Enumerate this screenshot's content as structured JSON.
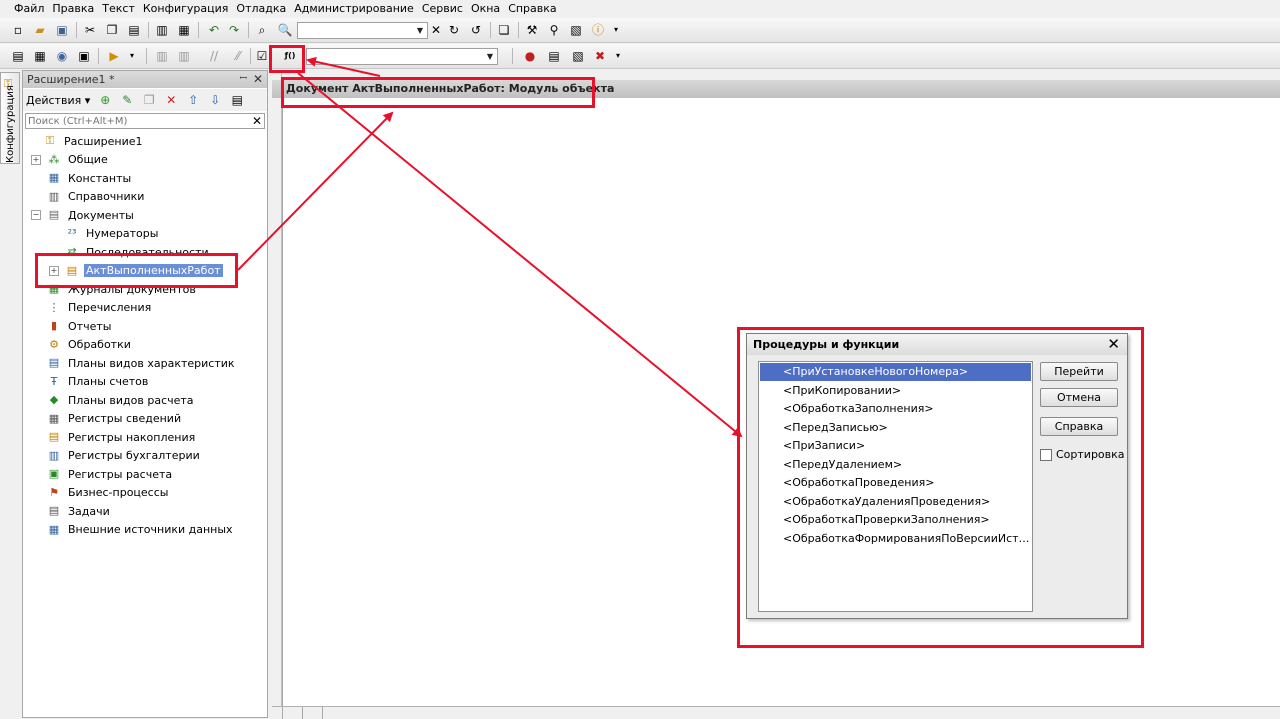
{
  "menu": [
    "Файл",
    "Правка",
    "Текст",
    "Конфигурация",
    "Отладка",
    "Администрирование",
    "Сервис",
    "Окна",
    "Справка"
  ],
  "vertical_tab": "Конфигурация",
  "panel": {
    "title": "Расширение1 *",
    "actions_label": "Действия ▾",
    "search_placeholder": "Поиск (Ctrl+Alt+M)"
  },
  "tree": [
    {
      "label": "Расширение1",
      "icon": "extension-icon",
      "level": 0,
      "expander": ""
    },
    {
      "label": "Общие",
      "icon": "common-icon",
      "level": 1,
      "expander": "+"
    },
    {
      "label": "Константы",
      "icon": "constants-icon",
      "level": 1,
      "expander": ""
    },
    {
      "label": "Справочники",
      "icon": "catalogs-icon",
      "level": 1,
      "expander": ""
    },
    {
      "label": "Документы",
      "icon": "documents-icon",
      "level": 1,
      "expander": "−"
    },
    {
      "label": "Нумераторы",
      "icon": "numerators-icon",
      "level": 2,
      "expander": ""
    },
    {
      "label": "Последовательности",
      "icon": "sequences-icon",
      "level": 2,
      "expander": ""
    },
    {
      "label": "АктВыполненныхРабот",
      "icon": "document-icon",
      "level": 2,
      "expander": "+",
      "selected": true
    },
    {
      "label": "Журналы документов",
      "icon": "journals-icon",
      "level": 1,
      "expander": ""
    },
    {
      "label": "Перечисления",
      "icon": "enums-icon",
      "level": 1,
      "expander": ""
    },
    {
      "label": "Отчеты",
      "icon": "reports-icon",
      "level": 1,
      "expander": ""
    },
    {
      "label": "Обработки",
      "icon": "processing-icon",
      "level": 1,
      "expander": ""
    },
    {
      "label": "Планы видов характеристик",
      "icon": "chart-char-icon",
      "level": 1,
      "expander": ""
    },
    {
      "label": "Планы счетов",
      "icon": "chart-accounts-icon",
      "level": 1,
      "expander": ""
    },
    {
      "label": "Планы видов расчета",
      "icon": "chart-calc-icon",
      "level": 1,
      "expander": ""
    },
    {
      "label": "Регистры сведений",
      "icon": "info-register-icon",
      "level": 1,
      "expander": ""
    },
    {
      "label": "Регистры накопления",
      "icon": "accum-register-icon",
      "level": 1,
      "expander": ""
    },
    {
      "label": "Регистры бухгалтерии",
      "icon": "account-register-icon",
      "level": 1,
      "expander": ""
    },
    {
      "label": "Регистры расчета",
      "icon": "calc-register-icon",
      "level": 1,
      "expander": ""
    },
    {
      "label": "Бизнес-процессы",
      "icon": "business-process-icon",
      "level": 1,
      "expander": ""
    },
    {
      "label": "Задачи",
      "icon": "tasks-icon",
      "level": 1,
      "expander": ""
    },
    {
      "label": "Внешние источники данных",
      "icon": "external-sources-icon",
      "level": 1,
      "expander": ""
    }
  ],
  "editor": {
    "title": "Документ АктВыполненныхРабот: Модуль объекта"
  },
  "dialog": {
    "title": "Процедуры и функции",
    "items": [
      "<ПриУстановкеНовогоНомера>",
      "<ПриКопировании>",
      "<ОбработкаЗаполнения>",
      "<ПередЗаписью>",
      "<ПриЗаписи>",
      "<ПередУдалением>",
      "<ОбработкаПроведения>",
      "<ОбработкаУдаленияПроведения>",
      "<ОбработкаПроверкиЗаполнения>",
      "<ОбработкаФормированияПоВерсииИсторииДанных>"
    ],
    "selected_index": 0,
    "buttons": {
      "go": "Перейти",
      "cancel": "Отмена",
      "help": "Справка"
    },
    "sort_label": "Сортировка",
    "sort_checked": false
  },
  "colors": {
    "annotation": "#e8102a",
    "selection": "#4e6ec5"
  }
}
